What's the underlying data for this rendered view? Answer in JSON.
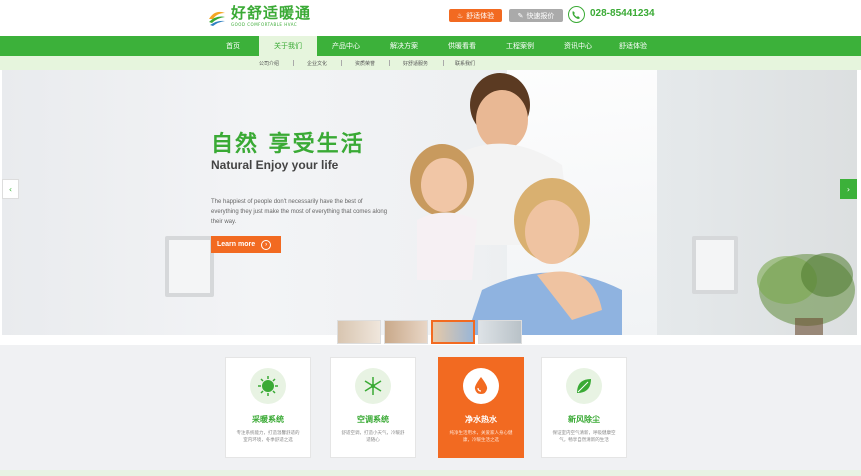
{
  "header": {
    "logo_cn": "好舒适暖通",
    "logo_en": "GOOD COMFORTABLE HVAC",
    "btn_experience": "舒适体验",
    "btn_quick_quote": "快速报价",
    "phone": "028-85441234"
  },
  "nav": {
    "items": [
      "首页",
      "关于我们",
      "产品中心",
      "解决方案",
      "供暖看看",
      "工程案例",
      "资讯中心",
      "舒适体验"
    ],
    "active_index": 1
  },
  "subnav": {
    "items": [
      "公司介绍",
      "企业文化",
      "资质荣誉",
      "好舒适服务",
      "联系我们"
    ]
  },
  "banner": {
    "title": "自然  享受生活",
    "subtitle": "Natural Enjoy your life",
    "description": "The happiest of people don't necessarily have the best of everything they just make the most of everything that comes along their way.",
    "learn_more": "Learn more",
    "prev": "‹",
    "next": "›"
  },
  "features": [
    {
      "title": "采暖系统",
      "desc": "专注系统能力，打造温馨舒适的室内环境，冬季舒适之选",
      "icon": "sun-icon"
    },
    {
      "title": "空调系统",
      "desc": "舒适空调，打造小天气，冷暖舒适随心",
      "icon": "snowflake-icon"
    },
    {
      "title": "净水热水",
      "desc": "纯净生活用水，关爱家人身心健康，冷暖生活之选",
      "icon": "water-drop-icon",
      "active": true
    },
    {
      "title": "新风除尘",
      "desc": "保证室内空气清新，呼吸健康空气，畅享自然清新的生活",
      "icon": "leaf-icon"
    }
  ],
  "colors": {
    "brand_green": "#3cb13a",
    "accent_orange": "#f26a21"
  }
}
